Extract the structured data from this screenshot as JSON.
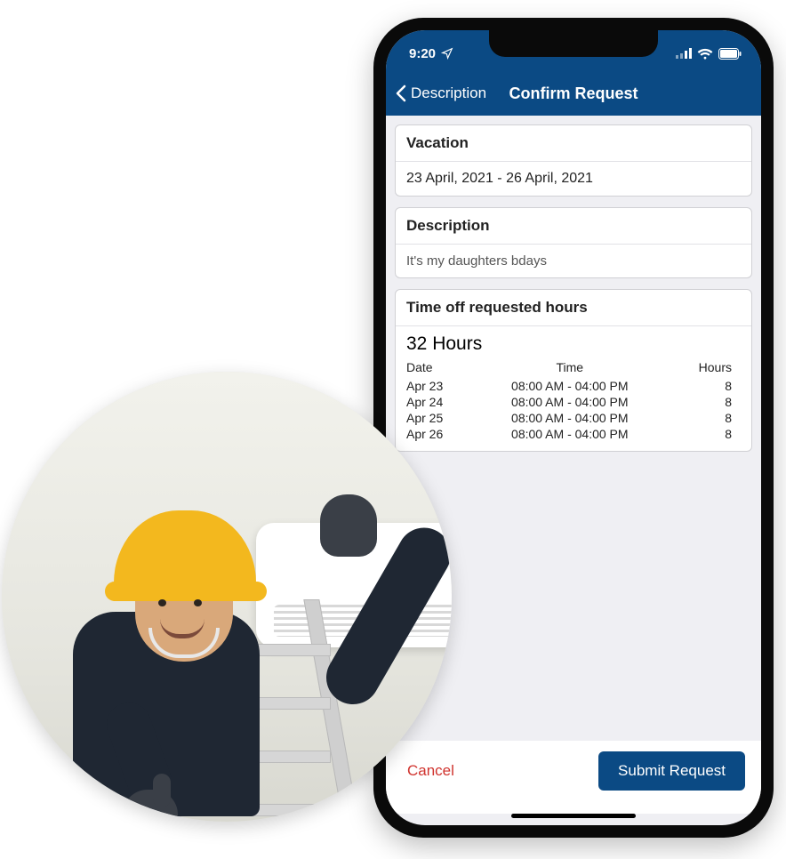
{
  "status": {
    "time": "9:20"
  },
  "nav": {
    "back_label": "Description",
    "title": "Confirm Request"
  },
  "request": {
    "type_label": "Vacation",
    "date_range": "23 April, 2021  - 26 April, 2021",
    "description_label": "Description",
    "description_value": "It's my daughters bdays",
    "hours_label": "Time off requested hours",
    "hours_total": "32 Hours",
    "columns": {
      "date": "Date",
      "time": "Time",
      "hours": "Hours"
    },
    "rows": [
      {
        "date": "Apr 23",
        "time": "08:00 AM - 04:00 PM",
        "hours": "8"
      },
      {
        "date": "Apr 24",
        "time": "08:00 AM - 04:00 PM",
        "hours": "8"
      },
      {
        "date": "Apr 25",
        "time": "08:00 AM - 04:00 PM",
        "hours": "8"
      },
      {
        "date": "Apr 26",
        "time": "08:00 AM - 04:00 PM",
        "hours": "8"
      }
    ]
  },
  "footer": {
    "cancel": "Cancel",
    "submit": "Submit Request"
  }
}
